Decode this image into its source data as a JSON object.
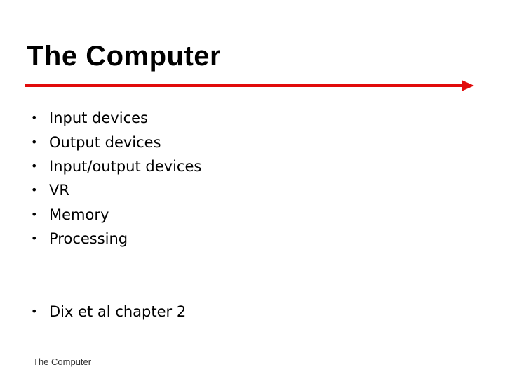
{
  "slide": {
    "title": "The Computer",
    "accent_color": "#e10b0b",
    "bullets": [
      "Input devices",
      "Output devices",
      "Input/output devices",
      "VR",
      "Memory",
      "Processing"
    ],
    "reference": "Dix et al chapter 2",
    "bullet_glyph": "•",
    "footer": "The Computer"
  }
}
